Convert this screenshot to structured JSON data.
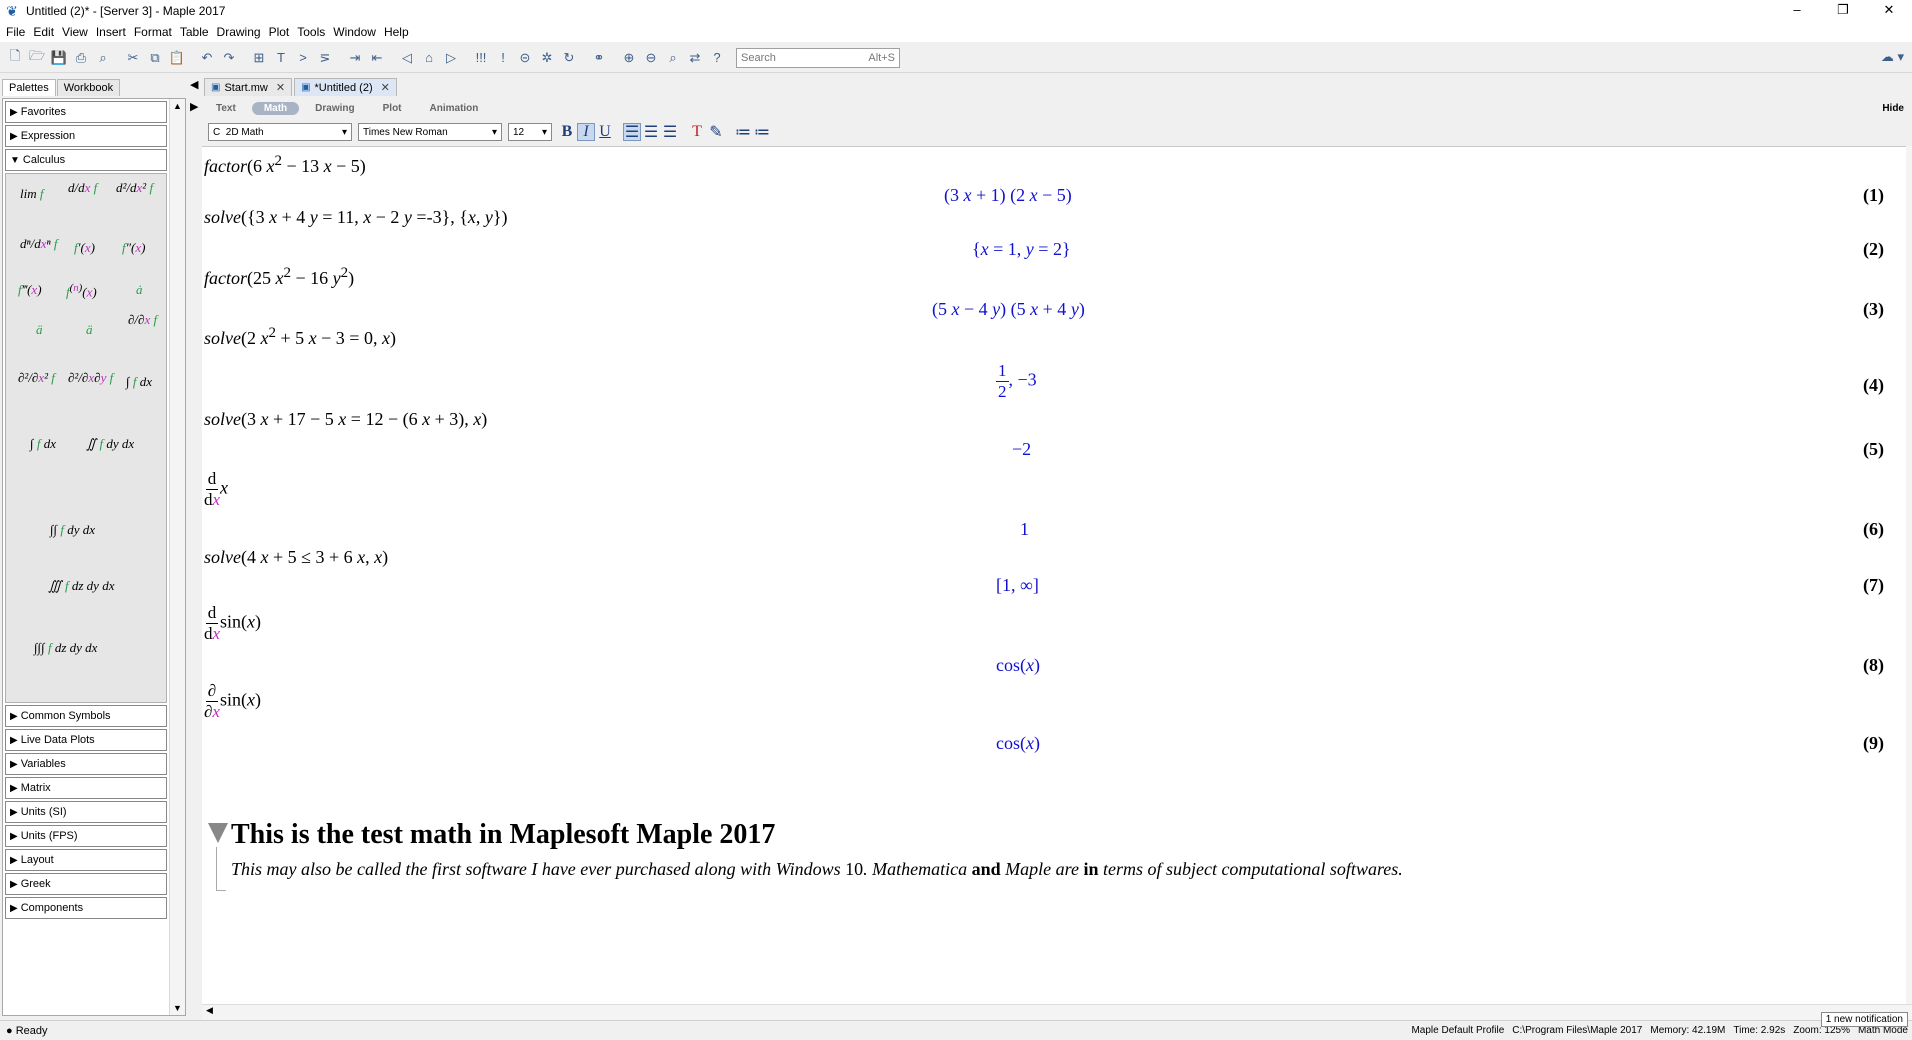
{
  "window": {
    "title": "Untitled (2)* - [Server 3] - Maple 2017",
    "min": "–",
    "restore": "❐",
    "close": "✕"
  },
  "menu": [
    "File",
    "Edit",
    "View",
    "Insert",
    "Format",
    "Table",
    "Drawing",
    "Plot",
    "Tools",
    "Window",
    "Help"
  ],
  "toolbar": {
    "search_placeholder": "Search",
    "search_shortcut": "Alt+S",
    "cloud_icon": "☁ ▾"
  },
  "palettes": {
    "tabs": [
      "Palettes",
      "Workbook"
    ],
    "headers_top": [
      "Favorites",
      "Expression",
      "Calculus"
    ],
    "headers_bottom": [
      "Common Symbols",
      "Live Data Plots",
      "Variables",
      "Matrix",
      "Units (SI)",
      "Units (FPS)",
      "Layout",
      "Greek",
      "Components"
    ]
  },
  "doc_tabs": [
    {
      "label": "Start.mw"
    },
    {
      "label": "*Untitled (2)"
    }
  ],
  "modes": [
    "Text",
    "Math",
    "Drawing",
    "Plot",
    "Animation"
  ],
  "hide_label": "Hide",
  "format": {
    "style": "2D Math",
    "style_prefix": "C",
    "font": "Times New Roman",
    "size": "12"
  },
  "equations": [
    {
      "input_html": "<i>factor</i>(6 <i>x</i><sup>2</sup> − 13 <i>x</i> − 5)",
      "output_html": "(3 <i>x</i> + 1) (2 <i>x</i> − 5)",
      "label": "(1)"
    },
    {
      "input_html": "<i>solve</i>({3 <i>x</i> + 4 <i>y</i> = 11, <i>x</i> − 2 <i>y</i> =-3}, {<i>x</i>, <i>y</i>})",
      "output_html": "{<i>x</i> = 1, <i>y</i> = 2}",
      "label": "(2)"
    },
    {
      "input_html": "<i>factor</i>(25 <i>x</i><sup>2</sup> − 16 <i>y</i><sup>2</sup>)",
      "output_html": "(5 <i>x</i> − 4 <i>y</i>) (5 <i>x</i> + 4 <i>y</i>)",
      "label": "(3)"
    },
    {
      "input_html": "<i>solve</i>(2 <i>x</i><sup>2</sup> + 5 <i>x</i> − 3 = 0, <i>x</i>)",
      "output_html": "<span class='frac'><span class='num'>1</span><span>2</span></span>, −3",
      "label": "(4)"
    },
    {
      "input_html": "<i>solve</i>(3 <i>x</i> + 17 − 5 <i>x</i> = 12 − (6 <i>x</i> + 3), <i>x</i>)",
      "output_html": "−2",
      "label": "(5)"
    },
    {
      "input_html": "<span class='frac'><span class='num'>d</span><span>d<i style='color:#c030c0'>x</i></span></span><i>x</i>",
      "output_html": "1",
      "label": "(6)"
    },
    {
      "input_html": "<i>solve</i>(4 <i>x</i> + 5 ≤ 3 + 6 <i>x</i>, <i>x</i>)",
      "output_html": "[1, ∞]",
      "label": "(7)"
    },
    {
      "input_html": "<span class='frac'><span class='num'>d</span><span>d<i style='color:#c030c0'>x</i></span></span>sin(<i>x</i>)",
      "output_html": "cos(<i>x</i>)",
      "label": "(8)"
    },
    {
      "input_html": "<span class='frac'><span class='num'>∂</span><span>∂<i style='color:#c030c0'>x</i></span></span>sin(<i>x</i>)",
      "output_html": "cos(<i>x</i>)",
      "label": "(9)"
    }
  ],
  "section": {
    "title": "This is the test math in Maplesoft Maple 2017",
    "text_html": "This may also be called the first software I have ever purchased along with Windows <span style='font-style:normal'>10</span>. Mathematica <b>and</b> Maple are <b>in</b> terms of subject computational softwares."
  },
  "status": {
    "ready": "Ready",
    "profile": "Maple Default Profile",
    "path": "C:\\Program Files\\Maple 2017",
    "memory": "Memory: 42.19M",
    "time": "Time: 2.92s",
    "zoom": "Zoom: 125%",
    "mode": "Math Mode",
    "notification": "1 new notification"
  }
}
